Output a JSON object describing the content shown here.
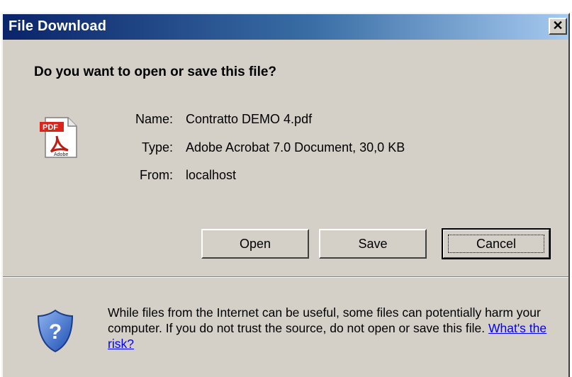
{
  "window": {
    "title": "File Download",
    "close_symbol": "✕"
  },
  "dialog": {
    "question": "Do you want to open or save this file?",
    "file_icon": "pdf-file-icon",
    "fields": [
      {
        "label": "Name:",
        "value": "Contratto DEMO 4.pdf"
      },
      {
        "label": "Type:",
        "value": "Adobe Acrobat 7.0 Document, 30,0 KB"
      },
      {
        "label": "From:",
        "value": "localhost"
      }
    ]
  },
  "buttons": {
    "open_label": "Open",
    "save_label": "Save",
    "cancel_label": "Cancel"
  },
  "warning": {
    "icon": "shield-question-icon",
    "text": "While files from the Internet can be useful, some files can potentially harm your computer. If you do not trust the source, do not open or save this file.",
    "link_text": "What's the risk?"
  },
  "colors": {
    "titlebar_start": "#0a246a",
    "titlebar_end": "#a6caf0",
    "dialog_bg": "#d4d0c8",
    "link": "#0000ff"
  }
}
